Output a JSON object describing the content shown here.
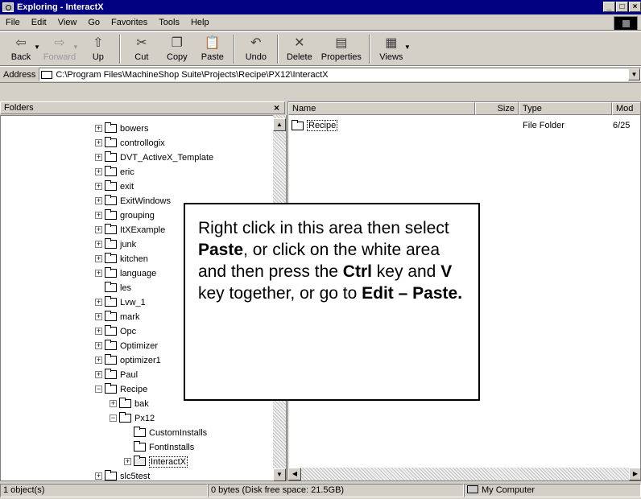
{
  "window": {
    "title": "Exploring - InteractX",
    "min": "_",
    "max": "□",
    "close": "×"
  },
  "menu": [
    {
      "label": "File"
    },
    {
      "label": "Edit"
    },
    {
      "label": "View"
    },
    {
      "label": "Go"
    },
    {
      "label": "Favorites"
    },
    {
      "label": "Tools"
    },
    {
      "label": "Help"
    }
  ],
  "toolbar": {
    "back": "Back",
    "forward": "Forward",
    "up": "Up",
    "cut": "Cut",
    "copy": "Copy",
    "paste": "Paste",
    "undo": "Undo",
    "delete": "Delete",
    "properties": "Properties",
    "views": "Views"
  },
  "address": {
    "label": "Address",
    "value": "C:\\Program Files\\MachineShop Suite\\Projects\\Recipe\\PX12\\InteractX"
  },
  "folders": {
    "header": "Folders",
    "close": "×",
    "items": [
      {
        "label": "bowers"
      },
      {
        "label": "controllogix"
      },
      {
        "label": "DVT_ActiveX_Template"
      },
      {
        "label": "eric"
      },
      {
        "label": "exit"
      },
      {
        "label": "ExitWindows"
      },
      {
        "label": "grouping"
      },
      {
        "label": "ItXExample"
      },
      {
        "label": "junk"
      },
      {
        "label": "kitchen"
      },
      {
        "label": "language"
      },
      {
        "label": "les"
      },
      {
        "label": "Lvw_1"
      },
      {
        "label": "mark"
      },
      {
        "label": "Opc"
      },
      {
        "label": "Optimizer"
      },
      {
        "label": "optimizer1"
      },
      {
        "label": "Paul"
      },
      {
        "label": "Recipe"
      },
      {
        "label": "bak"
      },
      {
        "label": "Px12"
      },
      {
        "label": "CustomInstalls"
      },
      {
        "label": "FontInstalls"
      },
      {
        "label": "InteractX"
      },
      {
        "label": "slc5test"
      }
    ]
  },
  "list": {
    "columns": {
      "name": "Name",
      "size": "Size",
      "type": "Type",
      "modified": "Mod"
    },
    "rows": [
      {
        "name": "Recipe",
        "type": "File Folder",
        "modified": "6/25"
      }
    ]
  },
  "callout": {
    "t1": "Right click in this area then select ",
    "b1": "Paste",
    "t2": ", or click on the white area and then press the ",
    "b2": "Ctrl",
    "t3": " key and ",
    "b3": "V",
    "t4": " key together, or go to ",
    "b4": "Edit – Paste."
  },
  "status": {
    "objects": "1 object(s)",
    "bytes": "0 bytes (Disk free space: 21.5GB)",
    "location": "My Computer"
  }
}
